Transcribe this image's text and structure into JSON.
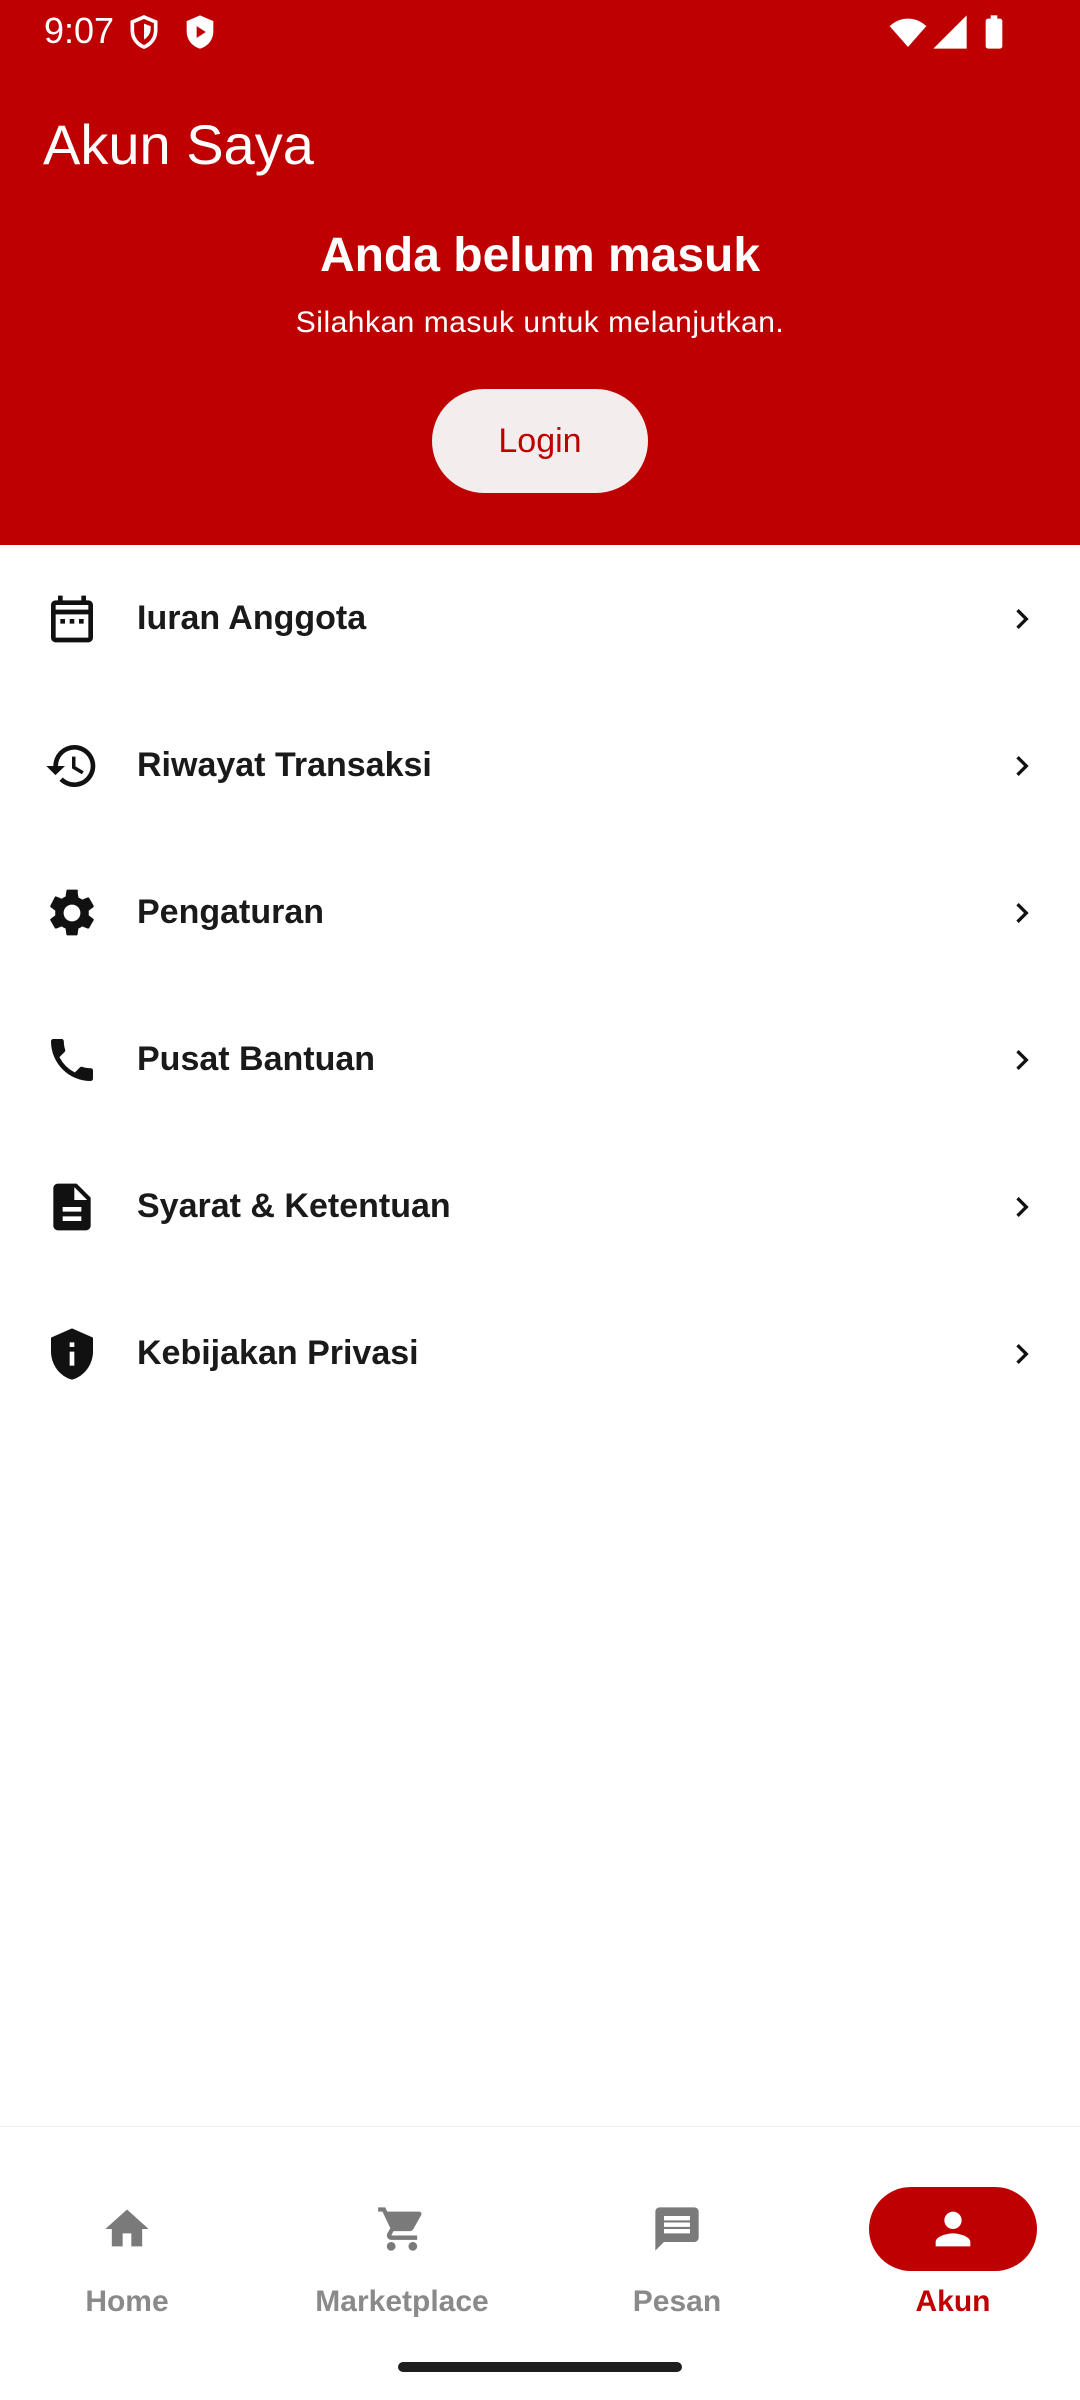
{
  "status_bar": {
    "time": "9:07",
    "icons": [
      "vpn-shield-icon",
      "play-protect-icon",
      "wifi-icon",
      "signal-icon",
      "battery-icon"
    ]
  },
  "header": {
    "title": "Akun Saya",
    "notice_title": "Anda belum masuk",
    "notice_subtitle": "Silahkan masuk untuk melanjutkan.",
    "login_label": "Login"
  },
  "menu": {
    "items": [
      {
        "label": "Iuran Anggota",
        "icon": "calendar-icon"
      },
      {
        "label": "Riwayat Transaksi",
        "icon": "history-icon"
      },
      {
        "label": "Pengaturan",
        "icon": "gear-icon"
      },
      {
        "label": "Pusat Bantuan",
        "icon": "phone-icon"
      },
      {
        "label": "Syarat & Ketentuan",
        "icon": "document-icon"
      },
      {
        "label": "Kebijakan Privasi",
        "icon": "privacy-shield-icon"
      }
    ]
  },
  "bottom_nav": {
    "items": [
      {
        "label": "Home",
        "icon": "home-icon",
        "active": false
      },
      {
        "label": "Marketplace",
        "icon": "cart-icon",
        "active": false
      },
      {
        "label": "Pesan",
        "icon": "message-icon",
        "active": false
      },
      {
        "label": "Akun",
        "icon": "person-icon",
        "active": true
      }
    ]
  },
  "colors": {
    "brand": "#be0000",
    "login_button_bg": "#f3eded",
    "inactive_nav": "#8a8a8a",
    "text_primary": "#1a1a1a"
  }
}
